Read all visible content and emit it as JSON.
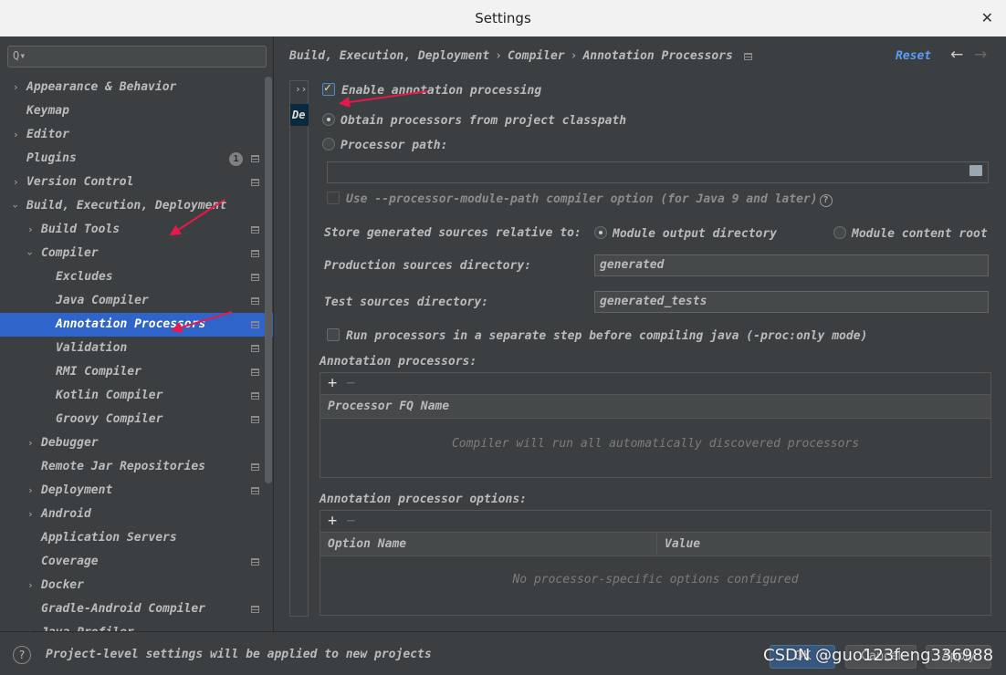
{
  "window": {
    "title": "Settings",
    "close": "✕"
  },
  "sidebar": {
    "search_placeholder": "",
    "search_icon": "Q▾",
    "items": [
      {
        "label": "Appearance & Behavior"
      },
      {
        "label": "Keymap"
      },
      {
        "label": "Editor"
      },
      {
        "label": "Plugins",
        "badge": "1"
      },
      {
        "label": "Version Control"
      },
      {
        "label": "Build, Execution, Deployment"
      },
      {
        "label": "Build Tools"
      },
      {
        "label": "Compiler"
      },
      {
        "label": "Excludes"
      },
      {
        "label": "Java Compiler"
      },
      {
        "label": "Annotation Processors"
      },
      {
        "label": "Validation"
      },
      {
        "label": "RMI Compiler"
      },
      {
        "label": "Kotlin Compiler"
      },
      {
        "label": "Groovy Compiler"
      },
      {
        "label": "Debugger"
      },
      {
        "label": "Remote Jar Repositories"
      },
      {
        "label": "Deployment"
      },
      {
        "label": "Android"
      },
      {
        "label": "Application Servers"
      },
      {
        "label": "Coverage"
      },
      {
        "label": "Docker"
      },
      {
        "label": "Gradle-Android Compiler"
      },
      {
        "label": "Java Profiler"
      }
    ]
  },
  "header": {
    "crumbs": [
      "Build, Execution, Deployment",
      "Compiler",
      "Annotation Processors"
    ],
    "sep": "›",
    "reset": "Reset",
    "back": "←",
    "forward": "→"
  },
  "modules": {
    "expand": "››",
    "selected": "De"
  },
  "form": {
    "enable_label": "Enable annotation processing",
    "obtain_label": "Obtain processors from project classpath",
    "path_label": "Processor path:",
    "path_value": "",
    "module_path_label": "Use --processor-module-path compiler option (for Java 9 and later)",
    "help": "?",
    "store_label": "Store generated sources relative to:",
    "store_opt1": "Module output directory",
    "store_opt2": "Module content root",
    "prod_label": "Production sources directory:",
    "prod_value": "generated",
    "test_label": "Test sources directory:",
    "test_value": "generated_tests",
    "separate_step_label": "Run processors in a separate step before compiling java (-proc:only mode)"
  },
  "processors_panel": {
    "title": "Annotation processors:",
    "add": "+",
    "remove": "−",
    "col": "Processor FQ Name",
    "empty": "Compiler will run all automatically discovered processors"
  },
  "options_panel": {
    "title": "Annotation processor options:",
    "add": "+",
    "remove": "−",
    "col1": "Option Name",
    "col2": "Value",
    "empty": "No processor-specific options configured"
  },
  "footer": {
    "help": "?",
    "note": "Project-level settings will be applied to new projects",
    "ok": "OK",
    "cancel": "Cancel",
    "apply": "Apply"
  },
  "watermark": "CSDN @guo123feng336988",
  "colors": {
    "accent": "#2f65ca",
    "link": "#589df6",
    "annotation_arrow": "#e8184a"
  }
}
